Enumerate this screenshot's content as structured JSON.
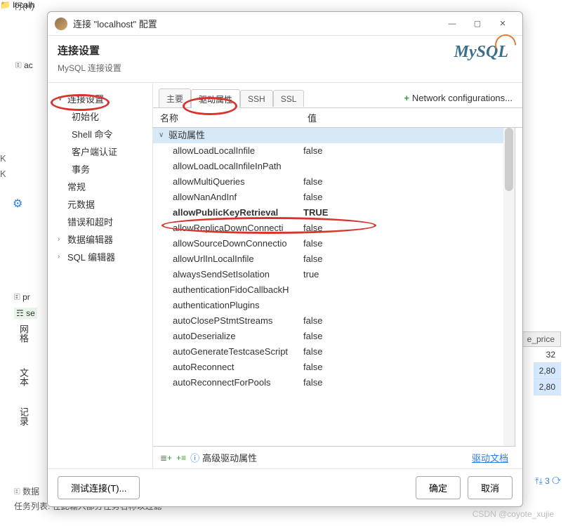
{
  "bg": {
    "menu_frag": "行(H)",
    "localhost": "localh",
    "tab_ac": "🗉 ac",
    "k": "K",
    "pr": "🗉 pr",
    "se": "☶ se",
    "vert1": "网格",
    "vert2": "文本",
    "vert3": "记录",
    "bottom_row": "🗉 数据",
    "bottom_task": "任务列表: 在此输入部分任务名称以过滤",
    "right_header": "e_price",
    "right_vals": [
      "32",
      "2,80",
      "2,80"
    ],
    "pager": "⤒⤓ 3 ⟳"
  },
  "dialog": {
    "title": "连接 \"localhost\" 配置",
    "header_title": "连接设置",
    "header_sub": "MySQL 连接设置",
    "logo": "MySQL"
  },
  "nav": {
    "items": [
      {
        "label": "连接设置",
        "chev": "∨",
        "indent": 0
      },
      {
        "label": "初始化",
        "indent": 1
      },
      {
        "label": "Shell 命令",
        "indent": 1
      },
      {
        "label": "客户端认证",
        "indent": 1
      },
      {
        "label": "事务",
        "indent": 1
      },
      {
        "label": "常规",
        "indent": 0
      },
      {
        "label": "元数据",
        "indent": 0
      },
      {
        "label": "错误和超时",
        "indent": 0
      },
      {
        "label": "数据编辑器",
        "chev": "›",
        "indent": 0
      },
      {
        "label": "SQL 编辑器",
        "chev": "›",
        "indent": 0
      }
    ]
  },
  "tabs": {
    "items": [
      "主要",
      "驱动属性",
      "SSH",
      "SSL"
    ],
    "active": 1,
    "network_btn": "Network configurations..."
  },
  "props": {
    "col_name": "名称",
    "col_val": "值",
    "group": "驱动属性",
    "rows": [
      {
        "name": "allowLoadLocalInfile",
        "val": "false"
      },
      {
        "name": "allowLoadLocalInfileInPath",
        "val": ""
      },
      {
        "name": "allowMultiQueries",
        "val": "false"
      },
      {
        "name": "allowNanAndInf",
        "val": "false"
      },
      {
        "name": "allowPublicKeyRetrieval",
        "val": "TRUE",
        "bold": true
      },
      {
        "name": "allowReplicaDownConnecti",
        "val": "false"
      },
      {
        "name": "allowSourceDownConnectio",
        "val": "false"
      },
      {
        "name": "allowUrlInLocalInfile",
        "val": "false"
      },
      {
        "name": "alwaysSendSetIsolation",
        "val": "true"
      },
      {
        "name": "authenticationFidoCallbackH",
        "val": ""
      },
      {
        "name": "authenticationPlugins",
        "val": ""
      },
      {
        "name": "autoClosePStmtStreams",
        "val": "false"
      },
      {
        "name": "autoDeserialize",
        "val": "false"
      },
      {
        "name": "autoGenerateTestcaseScript",
        "val": "false"
      },
      {
        "name": "autoReconnect",
        "val": "false"
      },
      {
        "name": "autoReconnectForPools",
        "val": "false"
      }
    ],
    "footer_text": "高级驱动属性",
    "footer_link": "驱动文档"
  },
  "buttons": {
    "test": "测试连接(T)...",
    "ok": "确定",
    "cancel": "取消"
  },
  "watermark": "CSDN @coyote_xujie"
}
